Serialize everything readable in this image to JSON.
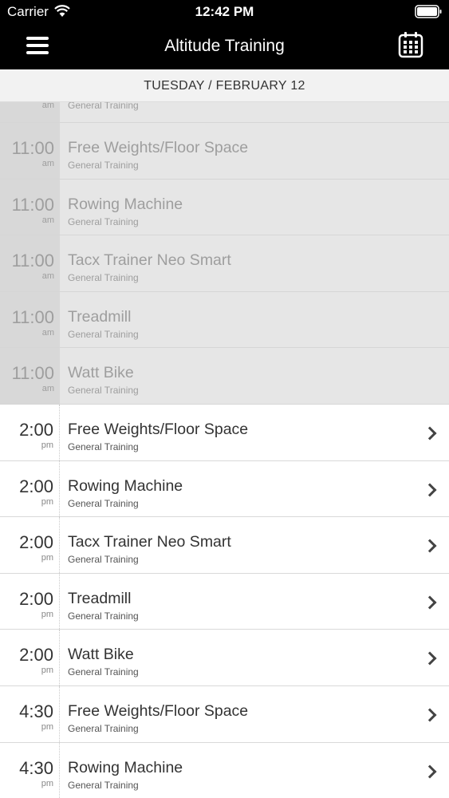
{
  "status_bar": {
    "carrier": "Carrier",
    "time": "12:42 PM"
  },
  "nav": {
    "title": "Altitude Training",
    "menu_icon": "hamburger-menu-icon",
    "calendar_icon": "calendar-icon"
  },
  "date_header": "TUESDAY / FEBRUARY 12",
  "partial_row": {
    "ampm": "am",
    "subtitle": "General Training"
  },
  "rows": [
    {
      "time": "11:00",
      "ampm": "am",
      "title": "Free Weights/Floor Space",
      "subtitle": "General Training",
      "past": true
    },
    {
      "time": "11:00",
      "ampm": "am",
      "title": "Rowing Machine",
      "subtitle": "General Training",
      "past": true
    },
    {
      "time": "11:00",
      "ampm": "am",
      "title": "Tacx Trainer Neo Smart",
      "subtitle": "General Training",
      "past": true
    },
    {
      "time": "11:00",
      "ampm": "am",
      "title": "Treadmill",
      "subtitle": "General Training",
      "past": true
    },
    {
      "time": "11:00",
      "ampm": "am",
      "title": "Watt Bike",
      "subtitle": "General Training",
      "past": true
    },
    {
      "time": "2:00",
      "ampm": "pm",
      "title": "Free Weights/Floor Space",
      "subtitle": "General Training",
      "past": false
    },
    {
      "time": "2:00",
      "ampm": "pm",
      "title": "Rowing Machine",
      "subtitle": "General Training",
      "past": false
    },
    {
      "time": "2:00",
      "ampm": "pm",
      "title": "Tacx Trainer Neo Smart",
      "subtitle": "General Training",
      "past": false
    },
    {
      "time": "2:00",
      "ampm": "pm",
      "title": "Treadmill",
      "subtitle": "General Training",
      "past": false
    },
    {
      "time": "2:00",
      "ampm": "pm",
      "title": "Watt Bike",
      "subtitle": "General Training",
      "past": false
    },
    {
      "time": "4:30",
      "ampm": "pm",
      "title": "Free Weights/Floor Space",
      "subtitle": "General Training",
      "past": false
    },
    {
      "time": "4:30",
      "ampm": "pm",
      "title": "Rowing Machine",
      "subtitle": "General Training",
      "past": false
    }
  ]
}
